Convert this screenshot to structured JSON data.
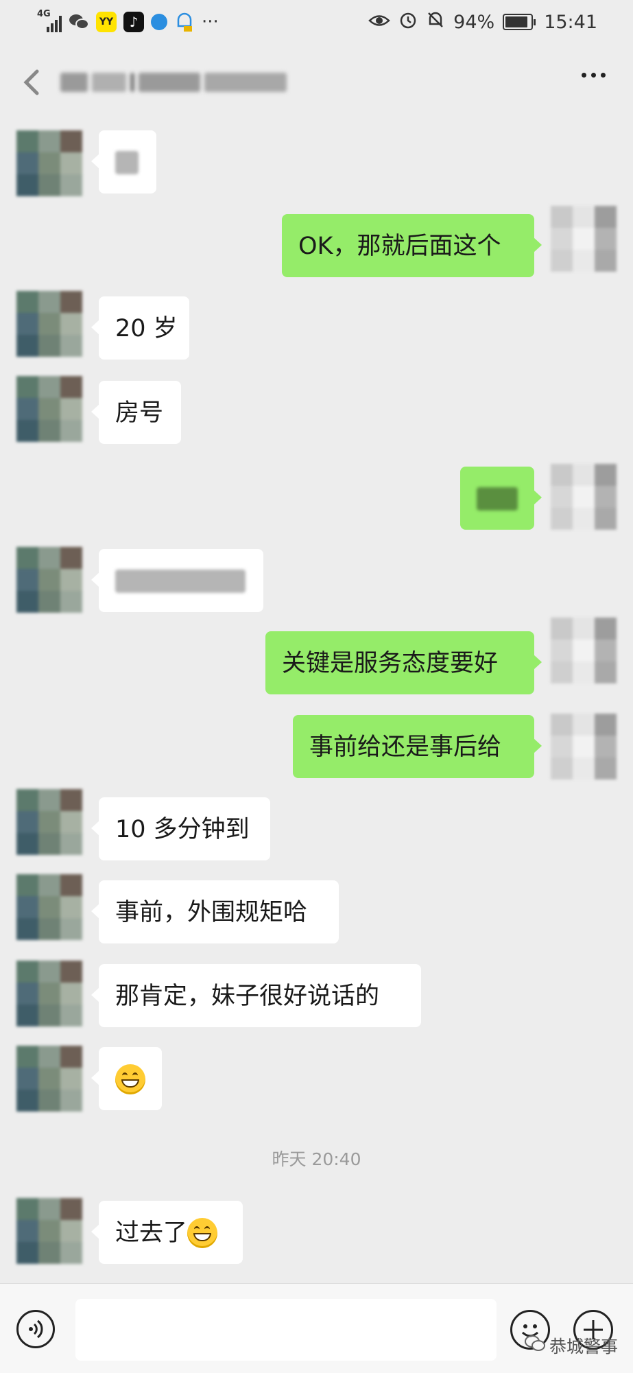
{
  "status_bar": {
    "network": "4G",
    "battery": "94%",
    "time": "15:41",
    "left_icons": [
      "signal-icon",
      "wechat-icon",
      "yy-app-icon",
      "tiktok-icon",
      "browser-icon",
      "notification-icon",
      "more-dots-icon"
    ],
    "right_icons": [
      "eye-comfort-icon",
      "alarm-icon",
      "mute-icon",
      "battery-icon"
    ]
  },
  "header": {
    "title": "",
    "back_icon": "back-arrow-icon",
    "menu_icon": "more-icon"
  },
  "messages": [
    {
      "side": "in",
      "text": ""
    },
    {
      "side": "out",
      "text": "OK，那就后面这个"
    },
    {
      "side": "in",
      "text": "20 岁"
    },
    {
      "side": "in",
      "text": "房号"
    },
    {
      "side": "out",
      "text": ""
    },
    {
      "side": "in",
      "text": ""
    },
    {
      "side": "out",
      "text": "关键是服务态度要好"
    },
    {
      "side": "out",
      "text": "事前给还是事后给"
    },
    {
      "side": "in",
      "text": "10 多分钟到"
    },
    {
      "side": "in",
      "text": "事前，外围规矩哈"
    },
    {
      "side": "in",
      "text": "那肯定，妹子很好说话的"
    },
    {
      "side": "in",
      "text": "",
      "emoji": "grin-emoji"
    },
    {
      "side": "in",
      "text": "过去了",
      "emoji": "grin-emoji"
    }
  ],
  "timestamp": "昨天 20:40",
  "input_bar": {
    "voice_icon": "voice-icon",
    "emoji_icon": "emoji-icon",
    "plus_icon": "plus-icon",
    "placeholder": ""
  },
  "watermark": "恭城警事",
  "colors": {
    "background": "#ededed",
    "outgoing_bubble": "#95ec69",
    "incoming_bubble": "#ffffff"
  }
}
